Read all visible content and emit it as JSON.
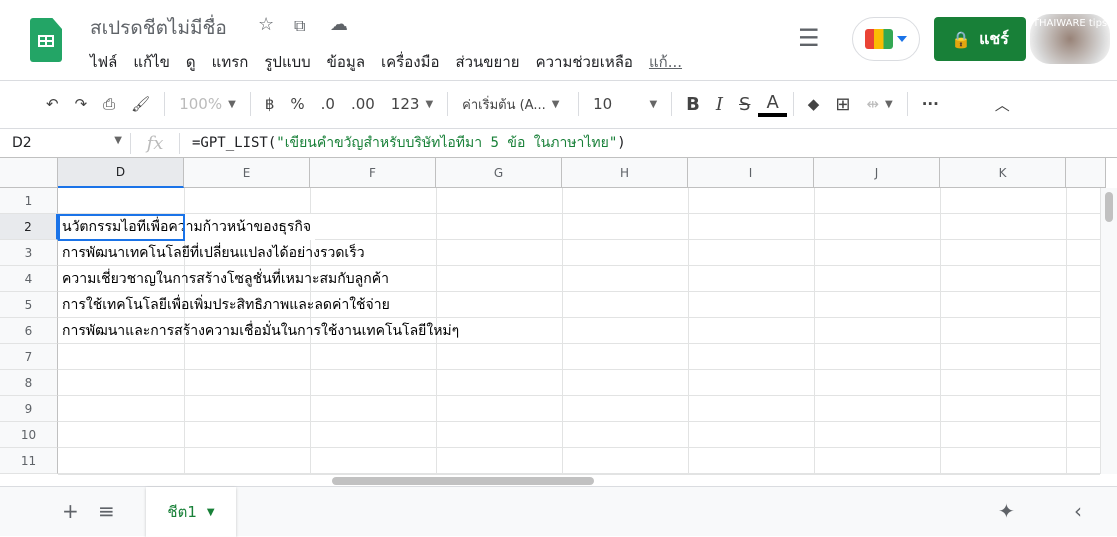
{
  "app": {
    "title": "สเปรดชีตไม่มีชื่อ",
    "share_label": "แชร์",
    "watermark": "THAIWARE tips"
  },
  "menu": [
    "ไฟล์",
    "แก้ไข",
    "ดู",
    "แทรก",
    "รูปแบบ",
    "ข้อมูล",
    "เครื่องมือ",
    "ส่วนขยาย",
    "ความช่วยเหลือ",
    "แก้..."
  ],
  "toolbar": {
    "zoom": "100%",
    "currency": "฿",
    "percent": "%",
    "dec_less": ".0",
    "dec_more": ".00",
    "format": "123",
    "font": "ค่าเริ่มต้น (A...",
    "size": "10"
  },
  "formula_bar": {
    "name_box": "D2",
    "fx": "fx",
    "prefix": "=GPT_LIST(",
    "string": "\"เขียนคำขวัญสำหรับบริษัทไอทีมา 5 ข้อ ในภาษาไทย\"",
    "suffix": ")"
  },
  "columns": [
    "D",
    "E",
    "F",
    "G",
    "H",
    "I",
    "J",
    "K"
  ],
  "rows": [
    "1",
    "2",
    "3",
    "4",
    "5",
    "6",
    "7",
    "8",
    "9",
    "10",
    "11"
  ],
  "cells": [
    "นวัตกรรมไอทีเพื่อความก้าวหน้าของธุรกิจ",
    "การพัฒนาเทคโนโลยีที่เปลี่ยนแปลงได้อย่างรวดเร็ว",
    "ความเชี่ยวชาญในการสร้างโซลูชั่นที่เหมาะสมกับลูกค้า",
    "การใช้เทคโนโลยีเพื่อเพิ่มประสิทธิภาพและลดค่าใช้จ่าย",
    "การพัฒนาและการสร้างความเชื่อมั่นในการใช้งานเทคโนโลยีใหม่ๆ"
  ],
  "sheets": [
    {
      "label": "ชีต1"
    }
  ],
  "colors": {
    "accent": "#188038",
    "selection": "#1a73e8"
  }
}
